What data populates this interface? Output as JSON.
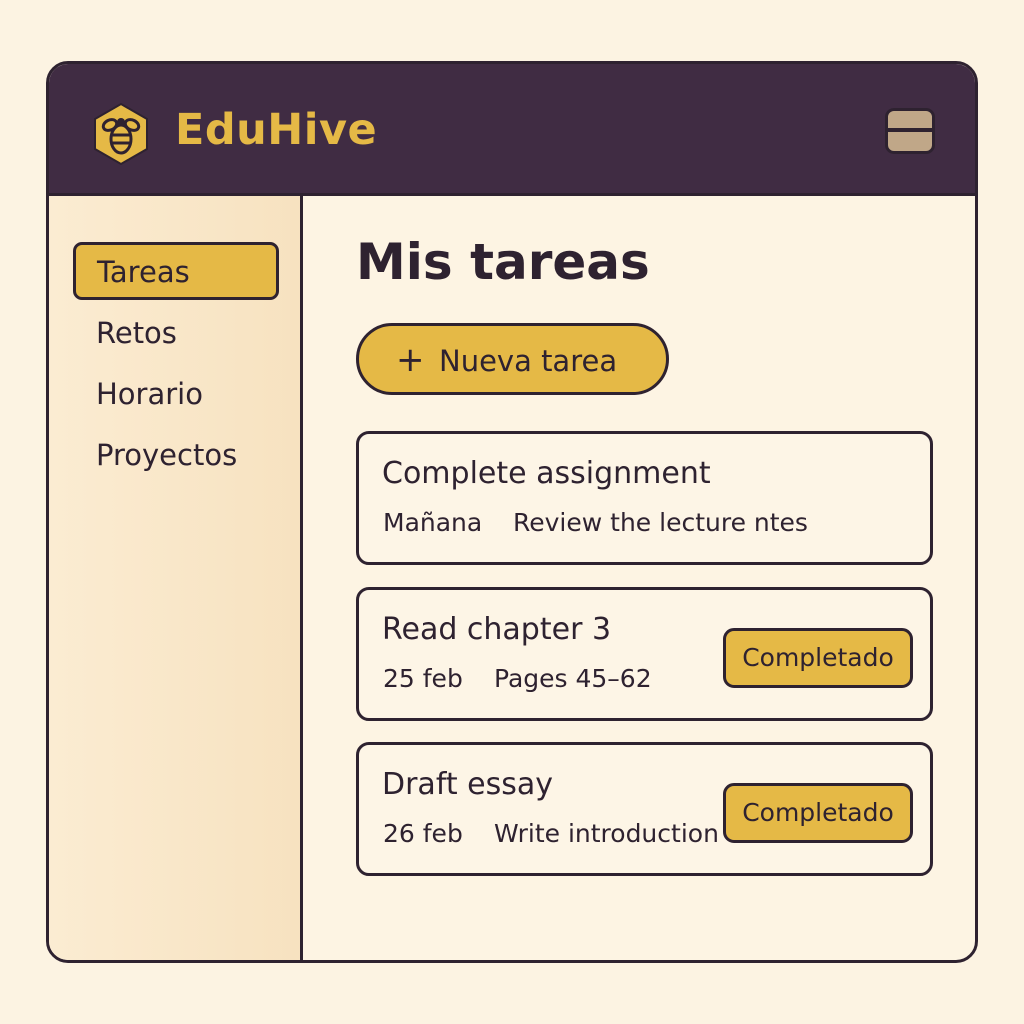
{
  "app": {
    "brand": "EduHive",
    "logo_icon": "bee-icon",
    "menu_icon": "menu-icon"
  },
  "colors": {
    "header_bg": "#402c43",
    "accent": "#e5b946",
    "outline": "#2e2230",
    "background": "#fcf3e2",
    "sidebar_bg": "#f7e2c0"
  },
  "sidebar": {
    "items": [
      {
        "label": "Tareas",
        "active": true
      },
      {
        "label": "Retos",
        "active": false
      },
      {
        "label": "Horario",
        "active": false
      },
      {
        "label": "Proyectos",
        "active": false
      }
    ]
  },
  "main": {
    "title": "Mis tareas",
    "new_task": {
      "icon": "plus-icon",
      "label": "Nueva tarea"
    },
    "tasks": [
      {
        "title": "Complete assignment",
        "date": "Mañana",
        "description": "Review the lecture ntes",
        "status": ""
      },
      {
        "title": "Read chapter 3",
        "date": "25 feb",
        "description": "Pages 45–62",
        "status": "Completado"
      },
      {
        "title": "Draft essay",
        "date": "26 feb",
        "description": "Write introduction",
        "status": "Completado"
      }
    ]
  }
}
